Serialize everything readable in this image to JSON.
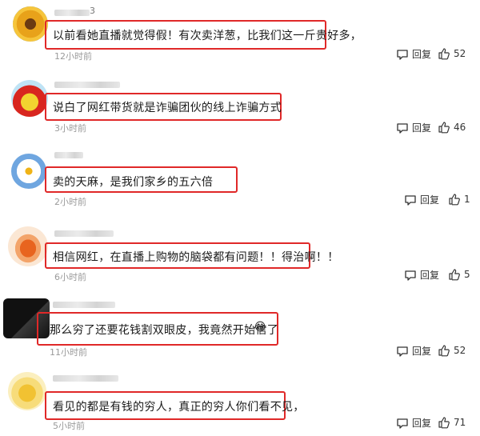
{
  "reply_label": "回复",
  "comments": [
    {
      "user_suffix": "3",
      "text": "以前看她直播就觉得假！有次卖洋葱，比我们这一斤贵好多，",
      "time": "12小时前",
      "likes": "52"
    },
    {
      "user_suffix": "",
      "text": "说白了网红带货就是诈骗团伙的线上诈骗方式",
      "time": "3小时前",
      "likes": "46"
    },
    {
      "user_suffix": "",
      "text": "卖的天麻，是我们家乡的五六倍",
      "time": "2小时前",
      "likes": "1"
    },
    {
      "user_suffix": "",
      "text": "相信网红，在直播上购物的脑袋都有问题！！得治啊！！",
      "time": "6小时前",
      "likes": "5"
    },
    {
      "user_suffix": "",
      "text": "那么穷了还要花钱割双眼皮，我竟然开始信了",
      "time": "11小时前",
      "likes": "52"
    },
    {
      "user_suffix": "",
      "text": "看见的都是有钱的穷人，真正的穷人你们看不见，",
      "time": "5小时前",
      "likes": "71"
    }
  ],
  "emoji": "😂"
}
